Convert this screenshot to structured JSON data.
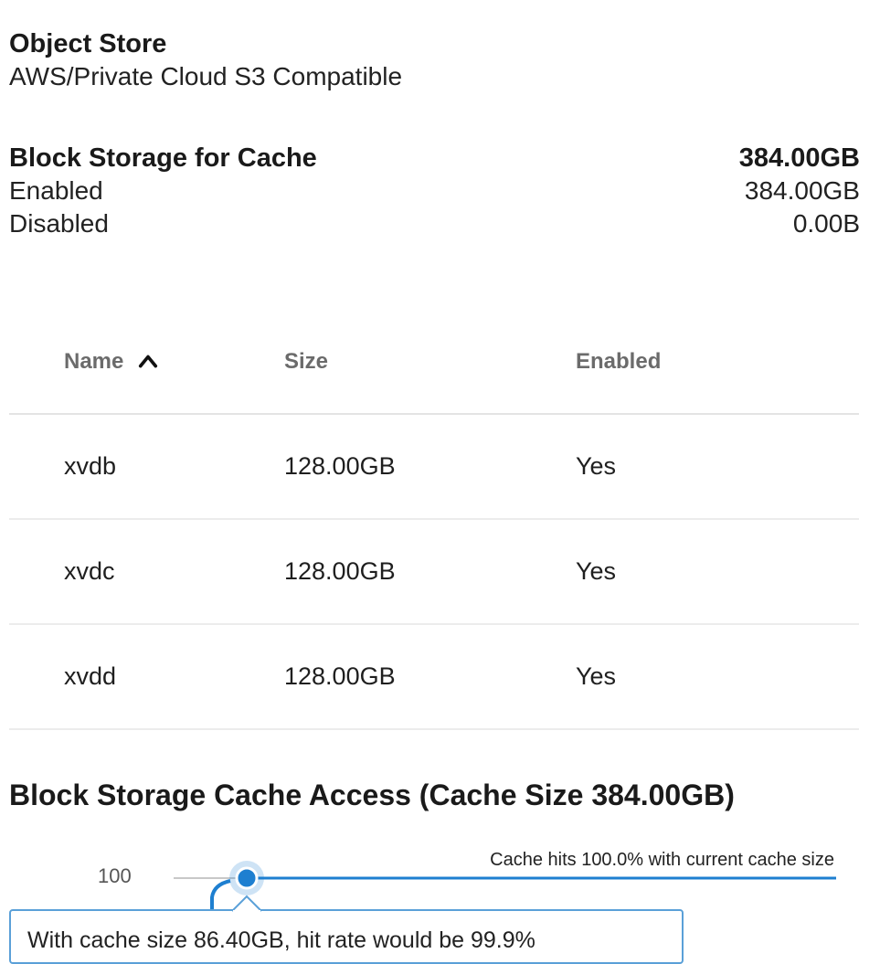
{
  "object_store": {
    "title": "Object Store",
    "subtitle": "AWS/Private Cloud S3 Compatible"
  },
  "block_storage": {
    "title": "Block Storage for Cache",
    "total": "384.00GB",
    "enabled_label": "Enabled",
    "enabled_value": "384.00GB",
    "disabled_label": "Disabled",
    "disabled_value": "0.00B"
  },
  "table": {
    "headers": [
      "Name",
      "Size",
      "Enabled"
    ],
    "rows": [
      [
        "xvdb",
        "128.00GB",
        "Yes"
      ],
      [
        "xvdc",
        "128.00GB",
        "Yes"
      ],
      [
        "xvdd",
        "128.00GB",
        "Yes"
      ]
    ]
  },
  "cache_access": {
    "title": "Block Storage Cache Access (Cache Size 384.00GB)",
    "y_tick": "100",
    "hits_label": "Cache hits 100.0% with current cache size",
    "tooltip": "With cache size 86.40GB, hit rate would be 99.9%",
    "line_color": "#1e7fd0"
  }
}
